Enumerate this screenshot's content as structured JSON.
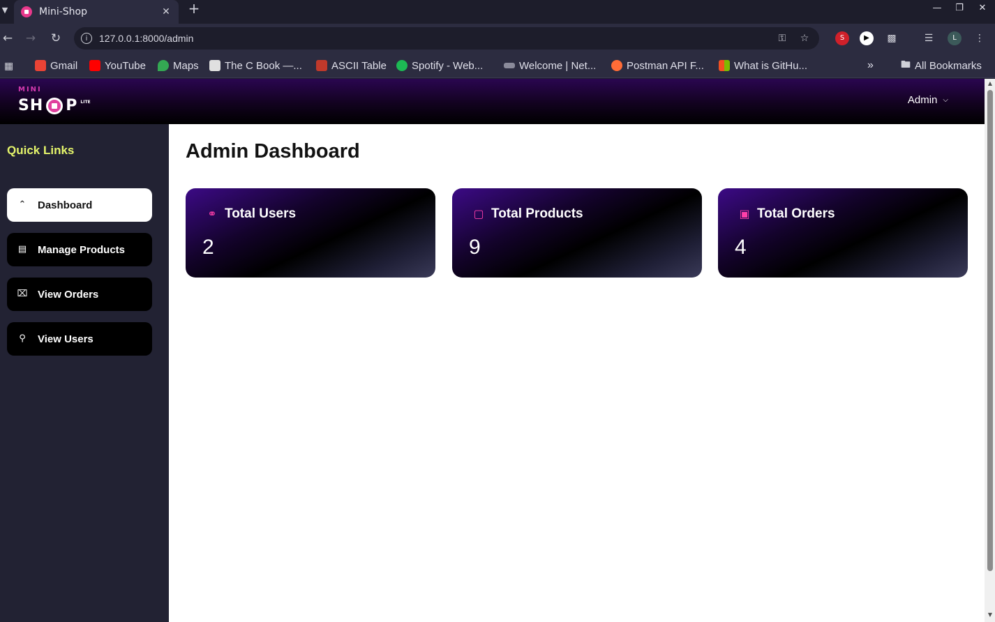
{
  "browser": {
    "tab_title": "Mini-Shop",
    "url": "127.0.0.1:8000/admin",
    "bookmarks": [
      {
        "label": "Gmail",
        "color": "#ea4335"
      },
      {
        "label": "YouTube",
        "color": "#ff0000"
      },
      {
        "label": "Maps",
        "color": "#34a853"
      },
      {
        "label": "The C Book —...",
        "color": "#e0e0e0"
      },
      {
        "label": "ASCII Table",
        "color": "#c0392b"
      },
      {
        "label": "Spotify - Web...",
        "color": "#1db954"
      },
      {
        "label": "Welcome | Net...",
        "color": "#8a8a9a"
      },
      {
        "label": "Postman API F...",
        "color": "#ff6c37"
      },
      {
        "label": "What is GitHu...",
        "color": "#7fba00"
      }
    ],
    "all_bookmarks": "All Bookmarks",
    "profile_initial": "L"
  },
  "header": {
    "logo_mini": "MINI",
    "logo_sh": "SH",
    "logo_p": "P",
    "logo_lite": "LITE",
    "admin_menu": "Admin"
  },
  "sidebar": {
    "title": "Quick Links",
    "items": [
      {
        "label": "Dashboard",
        "icon": "dashboard-icon"
      },
      {
        "label": "Manage Products",
        "icon": "products-icon"
      },
      {
        "label": "View Orders",
        "icon": "orders-icon"
      },
      {
        "label": "View Users",
        "icon": "users-icon"
      }
    ]
  },
  "main": {
    "title": "Admin Dashboard",
    "cards": [
      {
        "title": "Total Users",
        "value": "2",
        "icon": "users-icon"
      },
      {
        "title": "Total Products",
        "value": "9",
        "icon": "bag-icon"
      },
      {
        "title": "Total Orders",
        "value": "4",
        "icon": "orders-icon"
      }
    ]
  },
  "colors": {
    "accent_pink": "#ff3fa8",
    "quick_links_yellow": "#e5f56b",
    "header_purple": "#2a0650"
  }
}
